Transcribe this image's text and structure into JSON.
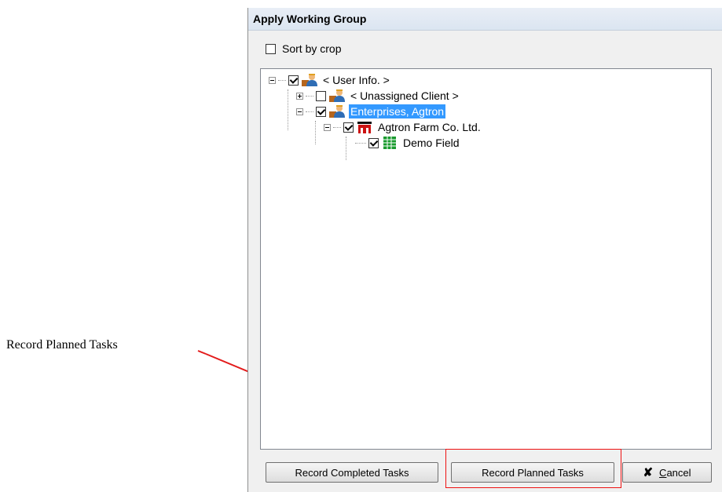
{
  "annotation": {
    "label": "Record Planned Tasks",
    "color": "#e31b1b"
  },
  "dialog": {
    "title": "Apply Working Group",
    "sort_by_crop": {
      "label": "Sort by crop",
      "checked": false
    },
    "tree": [
      {
        "label": "< User Info. >",
        "icon": "user-group-icon",
        "checked": true,
        "expander": "minus"
      },
      {
        "label": "< Unassigned Client >",
        "icon": "user-group-icon",
        "checked": false,
        "expander": "plus"
      },
      {
        "label": "Enterprises, Agtron",
        "icon": "user-group-icon",
        "checked": true,
        "expander": "minus",
        "selected": true
      },
      {
        "label": "Agtron Farm Co. Ltd.",
        "icon": "farm-barn-icon",
        "checked": true,
        "expander": "minus"
      },
      {
        "label": "Demo Field",
        "icon": "field-grid-icon",
        "checked": true
      }
    ],
    "buttons": {
      "completed": "Record Completed Tasks",
      "planned": "Record Planned Tasks",
      "cancel_prefix": "C",
      "cancel_rest": "ancel"
    },
    "selection_color": "#3399ff"
  }
}
